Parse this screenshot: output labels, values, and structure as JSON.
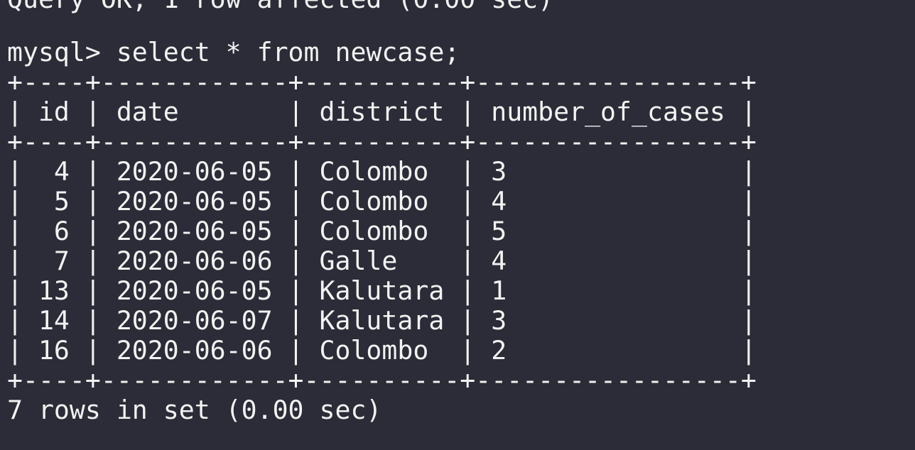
{
  "terminal": {
    "partial_line": "Query OK, 1 row affected (0.00 sec)",
    "blank_line": "",
    "prompt": "mysql> select * from newcase;",
    "border_top": "+----+------------+----------+-----------------+",
    "header_row": "| id | date       | district | number_of_cases |",
    "border_mid": "+----+------------+----------+-----------------+",
    "rows": [
      "|  4 | 2020-06-05 | Colombo  | 3               |",
      "|  5 | 2020-06-05 | Colombo  | 4               |",
      "|  6 | 2020-06-05 | Colombo  | 5               |",
      "|  7 | 2020-06-06 | Galle    | 4               |",
      "| 13 | 2020-06-05 | Kalutara | 1               |",
      "| 14 | 2020-06-07 | Kalutara | 3               |",
      "| 16 | 2020-06-06 | Colombo  | 2               |"
    ],
    "border_bottom": "+----+------------+----------+-----------------+",
    "summary": "7 rows in set (0.00 sec)"
  },
  "colors": {
    "background": "#2b2c37",
    "text": "#f2f2f2"
  }
}
